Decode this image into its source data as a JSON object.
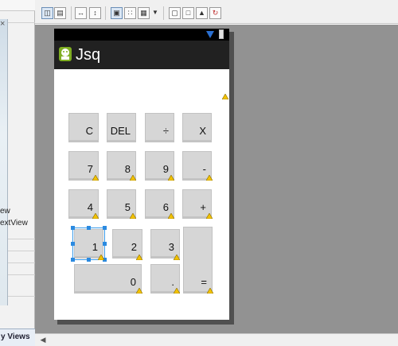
{
  "left_panel": {
    "close_glyph": "×",
    "labels": [
      "ew",
      "extView"
    ],
    "bottom_tab": "y Views"
  },
  "toolbar": {
    "icons": [
      "layout-horizontal-icon",
      "layout-vertical-icon",
      "fit-width-icon",
      "fit-height-icon",
      "toggle-fill-icon",
      "toggle-grid-icon",
      "dropdown-arrow-icon",
      "emulate-screen-icon",
      "preview-icon",
      "shortcut-icon",
      "refresh-icon"
    ]
  },
  "device": {
    "app_title": "Jsq",
    "colors": {
      "status_bar": "#000000",
      "action_bar": "#212121",
      "button": "#d6d6d6",
      "selection": "#2b8ae0",
      "warning": "#f2c200"
    }
  },
  "calculator": {
    "row1": [
      "C",
      "DEL",
      "÷",
      "X"
    ],
    "row2": [
      "7",
      "8",
      "9",
      "-"
    ],
    "row3": [
      "4",
      "5",
      "6",
      "+"
    ],
    "row4": [
      "1",
      "2",
      "3",
      "="
    ],
    "row5": [
      "0",
      "."
    ]
  }
}
